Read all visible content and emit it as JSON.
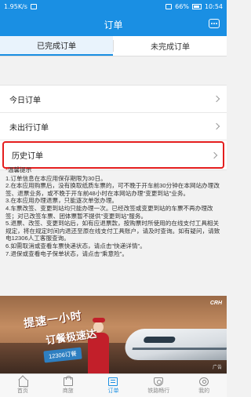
{
  "status_bar": {
    "network_speed": "1.95K/s",
    "battery_percent": "66%",
    "time": "10:54"
  },
  "navbar": {
    "title": "订单"
  },
  "tabs": [
    {
      "label": "已完成订单",
      "active": true
    },
    {
      "label": "未完成订单",
      "active": false
    }
  ],
  "order_list": [
    {
      "label": "今日订单"
    },
    {
      "label": "未出行订单"
    },
    {
      "label": "历史订单",
      "highlighted": true
    }
  ],
  "tips": {
    "heading": "温馨提示",
    "lines": [
      "1.订单信息在本应用保存期限为30日。",
      "2.在本应用购票后，没有换取纸质车票的，可不晚于开车前30分钟在本网站办理改签、退票业务，或不晚于开车前48小时在本网站办理\"变更到站\"业务。",
      "3.在本应用办理退票，只能逐次单张办理。",
      "4.车票改签、变更到站均只能办理一次。已经改签或变更到站的车票不再办理改签；对已改签车票、团体票暂不提供\"变更到站\"服务。",
      "5.退票、改签、变更到站后，如有应退票款，按购票时所使用的在线支付工具相关规定，将在规定时间内退还至原在线支付工具账户，请及时查询。如有疑问，请致电12306人工客服查询。",
      "6.如需取消或查看车票快递状态，请点击\"快递详情\"。",
      "7.退保或查看电子保单状态，请点击\"乘意险\"。"
    ]
  },
  "banner": {
    "logo_text": "CRH",
    "slogan_line1": "提速一小时",
    "slogan_line2": "订餐极速达",
    "tag": "12306订餐",
    "ad_label": "广告"
  },
  "bottom_tabs": [
    {
      "label": "首页",
      "icon": "home-icon",
      "active": false
    },
    {
      "label": "商旅",
      "icon": "mall-icon",
      "active": false
    },
    {
      "label": "订单",
      "icon": "order-icon",
      "active": true
    },
    {
      "label": "铁路畅行",
      "icon": "railway-icon",
      "active": false
    },
    {
      "label": "我的",
      "icon": "profile-icon",
      "active": false
    }
  ],
  "colors": {
    "primary": "#1a8fe3",
    "highlight_border": "#e41e1e",
    "warning_star": "#e41e1e"
  }
}
